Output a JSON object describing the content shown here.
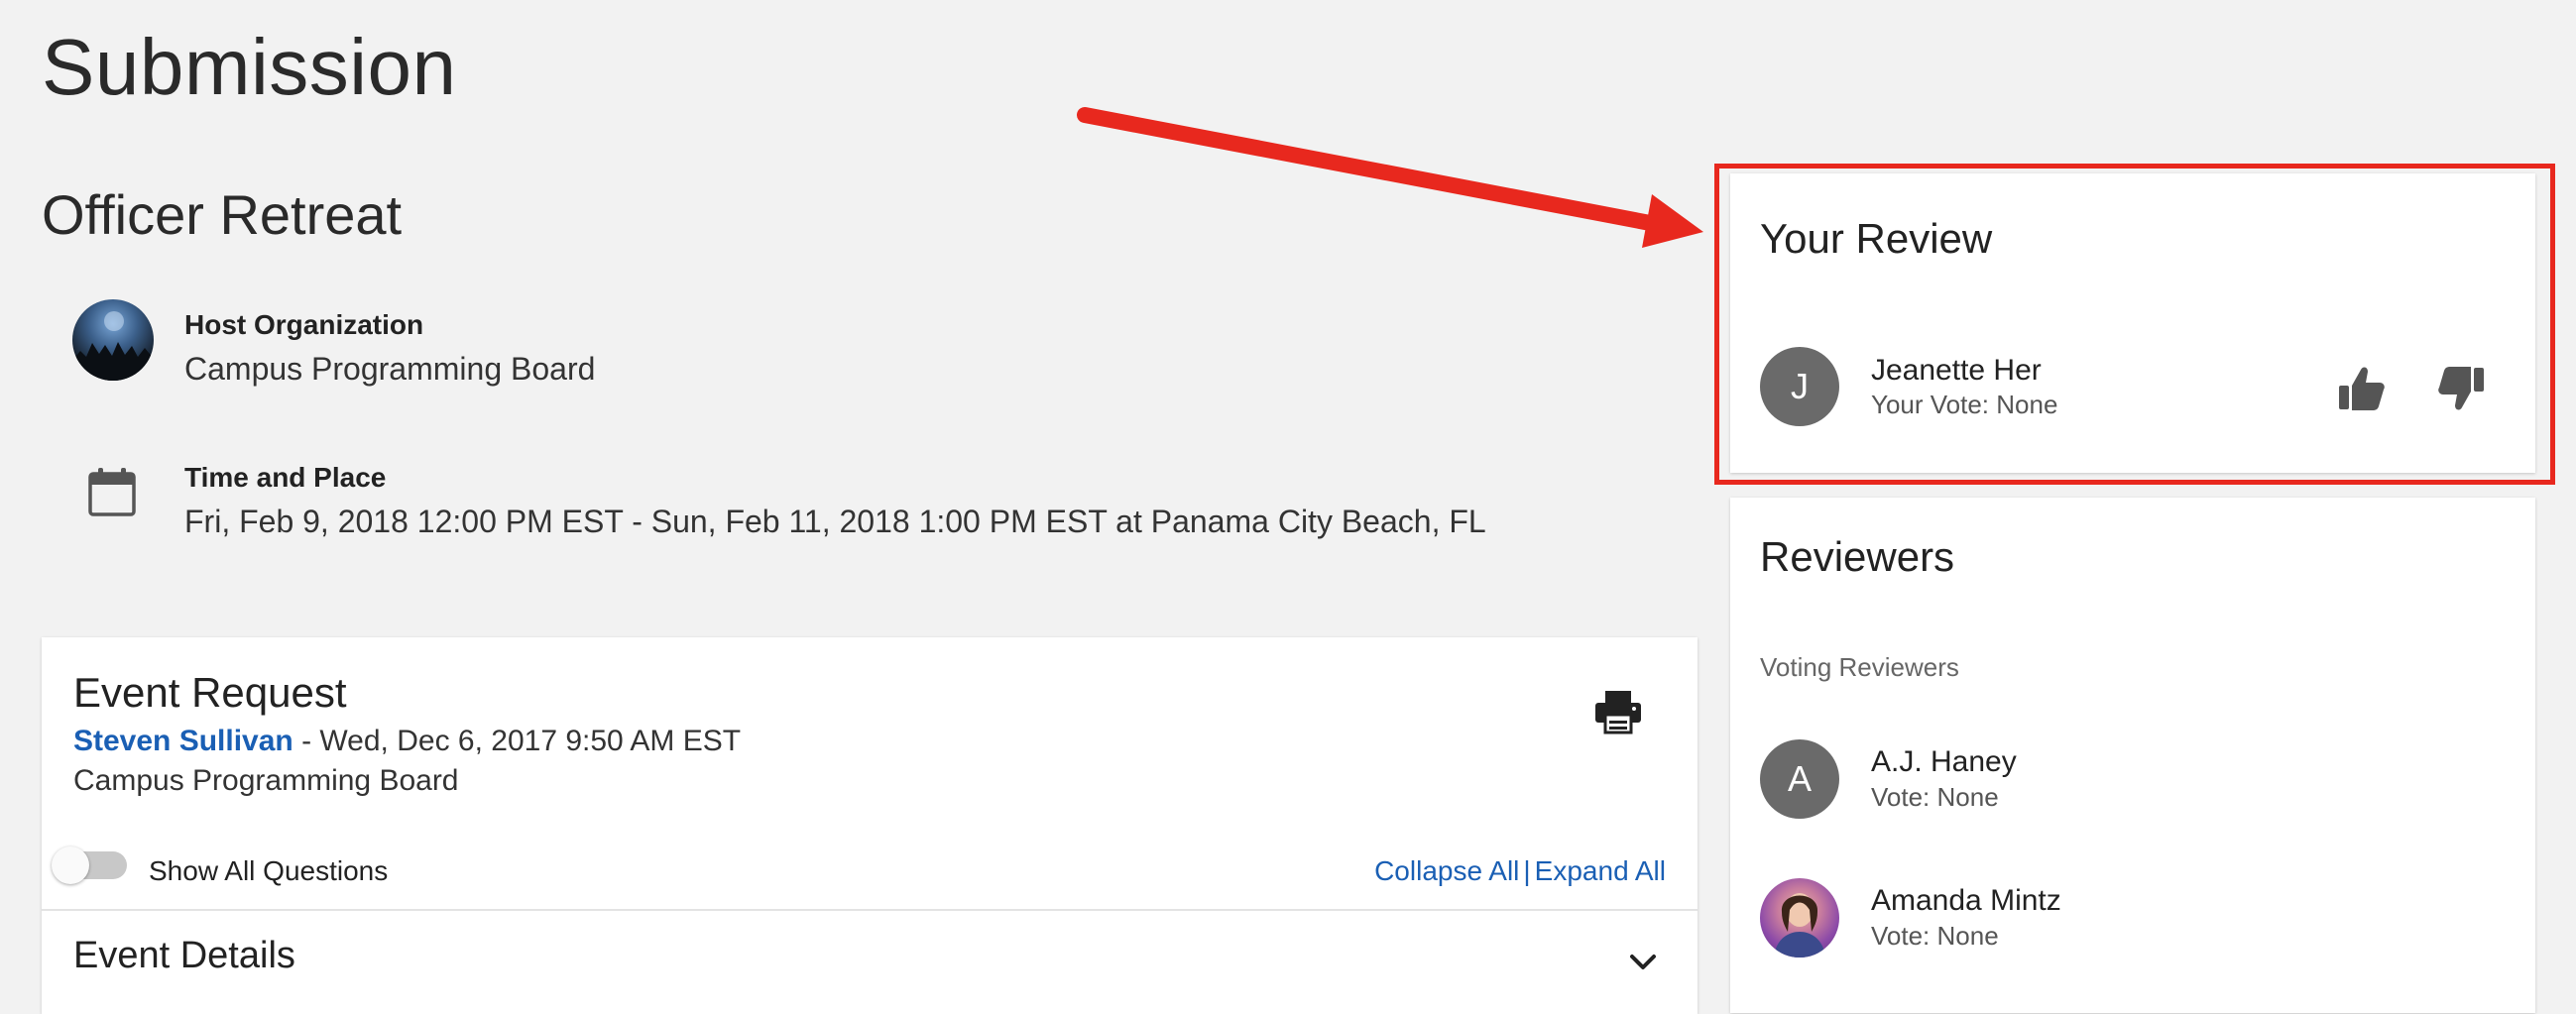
{
  "page": {
    "title": "Submission"
  },
  "event": {
    "name": "Officer Retreat",
    "host_label": "Host Organization",
    "host_value": "Campus Programming Board",
    "time_label": "Time and Place",
    "time_value": "Fri, Feb 9, 2018 12:00 PM EST - Sun, Feb 11, 2018 1:00 PM EST at Panama City Beach, FL"
  },
  "request": {
    "title": "Event Request",
    "author": "Steven Sullivan",
    "date_text": " - Wed, Dec 6, 2017 9:50 AM EST",
    "organization": "Campus Programming Board",
    "toggle_label": "Show All Questions",
    "collapse_all": "Collapse All",
    "separator": "|",
    "expand_all": "Expand All",
    "section_title": "Event Details"
  },
  "your_review": {
    "title": "Your Review",
    "user_initial": "J",
    "user_name": "Jeanette Her",
    "vote_text": "Your Vote: None"
  },
  "reviewers": {
    "title": "Reviewers",
    "subheading": "Voting Reviewers",
    "items": [
      {
        "initial": "A",
        "name": "A.J. Haney",
        "vote": "Vote: None"
      },
      {
        "initial": "",
        "name": "Amanda Mintz",
        "vote": "Vote: None"
      }
    ]
  },
  "colors": {
    "link": "#1a5fb4",
    "annotation": "#e8281e",
    "avatar": "#6a6a6a",
    "background": "#f2f2f2"
  },
  "icons": [
    "calendar-icon",
    "print-icon",
    "chevron-down-icon",
    "thumbs-up-icon",
    "thumbs-down-icon"
  ]
}
